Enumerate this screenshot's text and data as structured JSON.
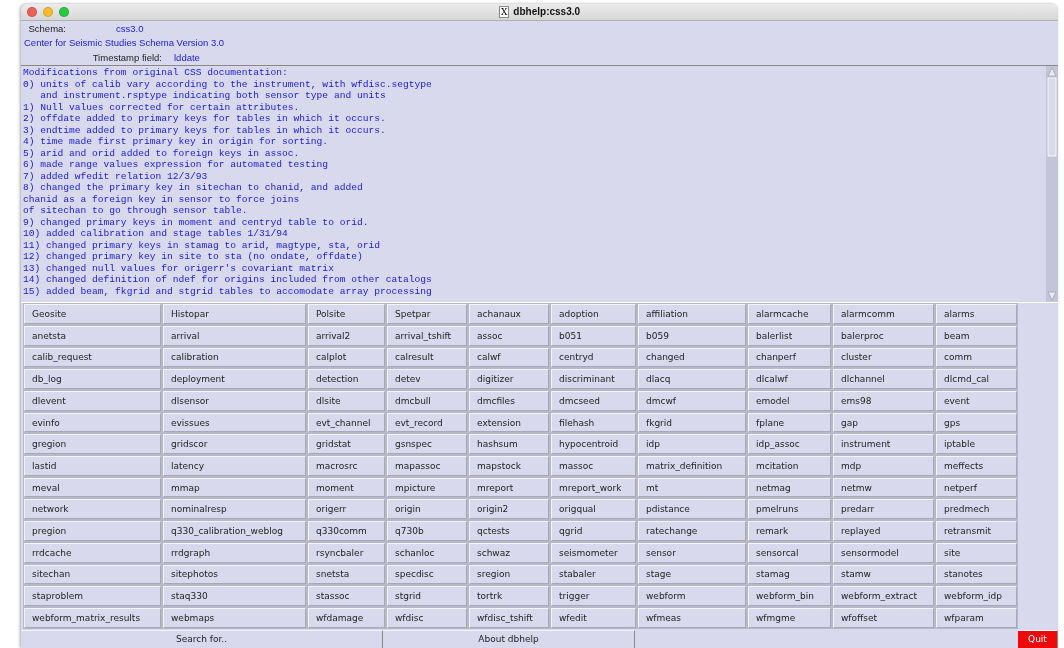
{
  "window": {
    "title": "dbhelp:css3.0",
    "title_icon": "X"
  },
  "header": {
    "schema_label": "Schema:",
    "schema_value": "css3.0",
    "description": "Center for Seismic Studies Schema Version 3.0",
    "timestamp_label": "Timestamp field:",
    "timestamp_value": "lddate"
  },
  "notes": [
    "Modifications from original CSS documentation:",
    "0) units of calib vary according to the instrument, with wfdisc.segtype",
    "   and instrument.rsptype indicating both sensor type and units",
    "1) Null values corrected for certain attributes.",
    "2) offdate added to primary keys for tables in which it occurs.",
    "3) endtime added to primary keys for tables in which it occurs.",
    "4) time made first primary key in origin for sorting.",
    "5) arid and orid added to foreign keys in assoc.",
    "6) made range values expression for automated testing",
    "7) added wfedit relation 12/3/93",
    "8) changed the primary key in sitechan to chanid, and added",
    "chanid as a foreign key in sensor to force joins",
    "of sitechan to go through sensor table.",
    "9) changed primary keys in moment and centryd table to orid.",
    "10) added calibration and stage tables 1/31/94",
    "11) changed primary keys in stamag to arid, magtype, sta, orid",
    "12) changed primary key in site to sta (no ondate, offdate)",
    "13) changed null values for origerr's covariant matrix",
    "14) changed definition of ndef for origins included from other catalogs",
    "15) added beam, fkgrid and stgrid tables to accomodate array processing"
  ],
  "tables": [
    [
      "Geosite",
      "Histopar",
      "Polsite",
      "Spetpar",
      "achanaux",
      "adoption",
      "affiliation",
      "alarmcache",
      "alarmcomm",
      "alarms"
    ],
    [
      "anetsta",
      "arrival",
      "arrival2",
      "arrival_tshift",
      "assoc",
      "b051",
      "b059",
      "balerlist",
      "balerproc",
      "beam"
    ],
    [
      "calib_request",
      "calibration",
      "calplot",
      "calresult",
      "calwf",
      "centryd",
      "changed",
      "chanperf",
      "cluster",
      "comm"
    ],
    [
      "db_log",
      "deployment",
      "detection",
      "detev",
      "digitizer",
      "discriminant",
      "dlacq",
      "dlcalwf",
      "dlchannel",
      "dlcmd_cal"
    ],
    [
      "dlevent",
      "dlsensor",
      "dlsite",
      "dmcbull",
      "dmcfiles",
      "dmcseed",
      "dmcwf",
      "emodel",
      "ems98",
      "event"
    ],
    [
      "evinfo",
      "evissues",
      "evt_channel",
      "evt_record",
      "extension",
      "filehash",
      "fkgrid",
      "fplane",
      "gap",
      "gps"
    ],
    [
      "gregion",
      "gridscor",
      "gridstat",
      "gsnspec",
      "hashsum",
      "hypocentroid",
      "idp",
      "idp_assoc",
      "instrument",
      "iptable"
    ],
    [
      "lastid",
      "latency",
      "macrosrc",
      "mapassoc",
      "mapstock",
      "massoc",
      "matrix_definition",
      "mcitation",
      "mdp",
      "meffects"
    ],
    [
      "meval",
      "mmap",
      "moment",
      "mpicture",
      "mreport",
      "mreport_work",
      "mt",
      "netmag",
      "netmw",
      "netperf"
    ],
    [
      "network",
      "nominalresp",
      "origerr",
      "origin",
      "origin2",
      "origqual",
      "pdistance",
      "pmelruns",
      "predarr",
      "predmech"
    ],
    [
      "pregion",
      "q330_calibration_weblog",
      "q330comm",
      "q730b",
      "qctests",
      "qgrid",
      "ratechange",
      "remark",
      "replayed",
      "retransmit"
    ],
    [
      "rrdcache",
      "rrdgraph",
      "rsyncbaler",
      "schanloc",
      "schwaz",
      "seismometer",
      "sensor",
      "sensorcal",
      "sensormodel",
      "site"
    ],
    [
      "sitechan",
      "sitephotos",
      "snetsta",
      "specdisc",
      "sregion",
      "stabaler",
      "stage",
      "stamag",
      "stamw",
      "stanotes"
    ],
    [
      "staproblem",
      "staq330",
      "stassoc",
      "stgrid",
      "tortrk",
      "trigger",
      "webform",
      "webform_bin",
      "webform_extract",
      "webform_idp"
    ],
    [
      "webform_matrix_results",
      "webmaps",
      "wfdamage",
      "wfdisc",
      "wfdisc_tshift",
      "wfedit",
      "wfmeas",
      "wfmgme",
      "wfoffset",
      "wfparam"
    ]
  ],
  "bottom_buttons": [
    {
      "label": "Search for..",
      "kind": "plain"
    },
    {
      "label": "About dbhelp",
      "kind": "plain"
    },
    {
      "label": "Quit",
      "kind": "danger"
    }
  ]
}
